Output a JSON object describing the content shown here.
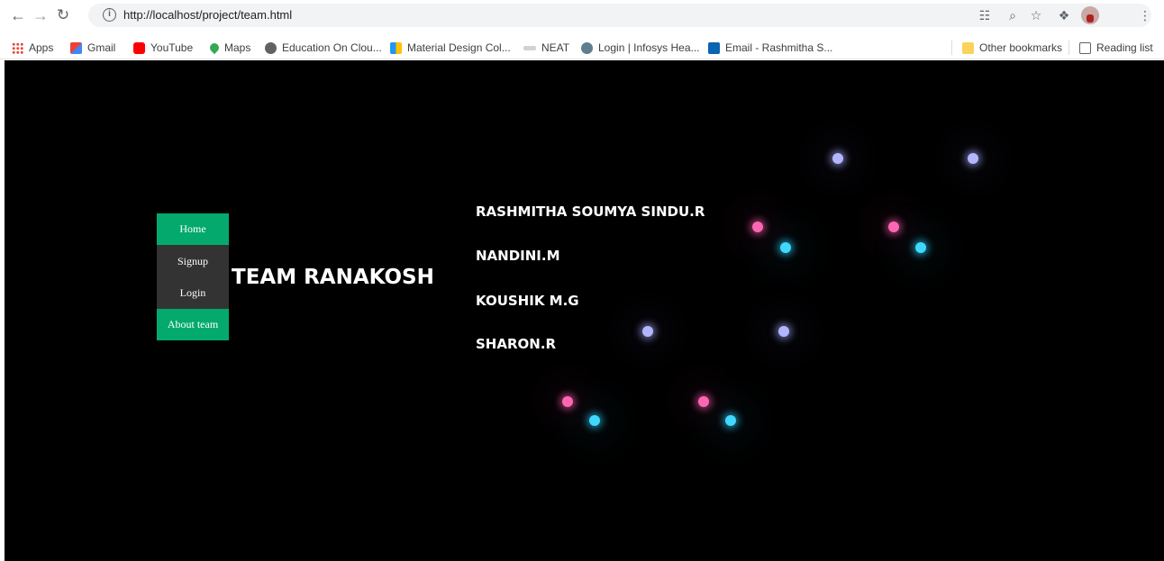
{
  "browser": {
    "url": "http://localhost/project/team.html",
    "info_glyph": "i",
    "bookmarks": [
      {
        "label": "Apps",
        "icon": "apps-grid-icon"
      },
      {
        "label": "Gmail",
        "icon": "gmail-icon"
      },
      {
        "label": "YouTube",
        "icon": "youtube-icon"
      },
      {
        "label": "Maps",
        "icon": "maps-icon"
      },
      {
        "label": "Education On Clou...",
        "icon": "globe-icon"
      },
      {
        "label": "Material Design Col...",
        "icon": "material-design-icon"
      },
      {
        "label": "NEAT",
        "icon": "neat-icon"
      },
      {
        "label": "Login | Infosys Hea...",
        "icon": "infosys-icon"
      },
      {
        "label": "Email - Rashmitha S...",
        "icon": "outlook-icon"
      },
      {
        "label": "Other bookmarks",
        "icon": "folder-icon"
      },
      {
        "label": "Reading list",
        "icon": "reading-list-icon"
      }
    ]
  },
  "sidenav": {
    "items": [
      {
        "label": "Home"
      },
      {
        "label": "Signup"
      },
      {
        "label": "Login"
      },
      {
        "label": "About team"
      }
    ]
  },
  "team": {
    "title": "TEAM RANAKOSH",
    "members": [
      "RASHMITHA SOUMYA SINDU.R",
      "NANDINI.M",
      "KOUSHIK M.G",
      "SHARON.R"
    ]
  },
  "colors": {
    "page_background": "#000000",
    "nav_active": "#04aa6d",
    "nav_default": "#333333",
    "dot_lavender": "#b3b6ff",
    "dot_pink": "#ff66b3",
    "dot_cyan": "#3fd8ff"
  }
}
